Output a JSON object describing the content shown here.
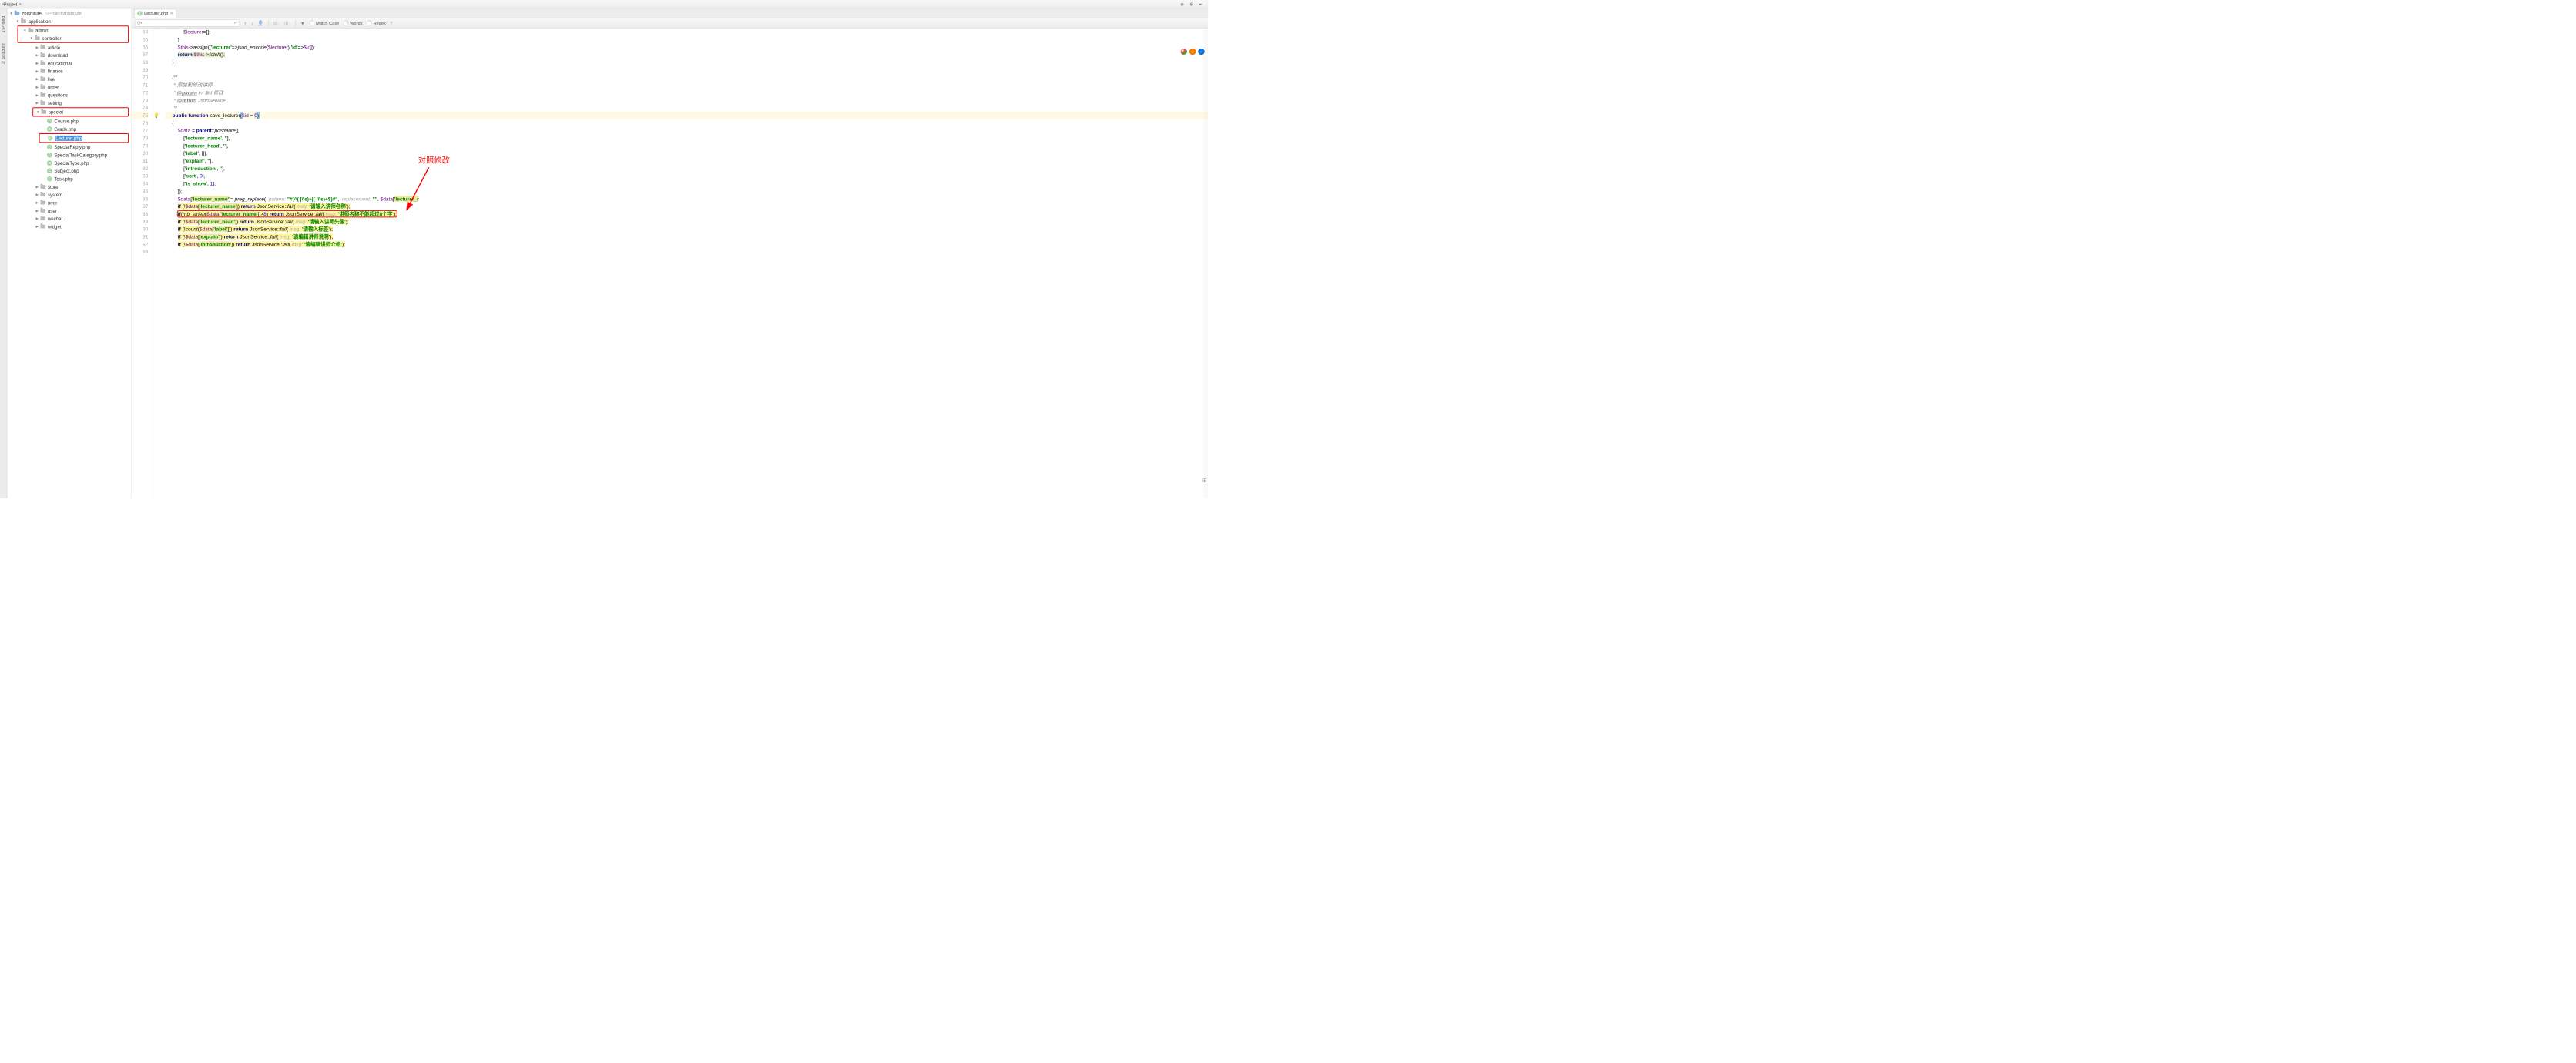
{
  "top_bar": {
    "label": "Project"
  },
  "tree": {
    "root": {
      "name": "zhishifufei",
      "path": "~/Project/zhishifufei"
    },
    "items": [
      {
        "name": "application",
        "indent": 1,
        "arrow": "down",
        "type": "folder"
      },
      {
        "name": "admin",
        "indent": 2,
        "arrow": "down",
        "type": "folder",
        "boxed_start": true
      },
      {
        "name": "controller",
        "indent": 3,
        "arrow": "down",
        "type": "folder",
        "boxed_end": true
      },
      {
        "name": "article",
        "indent": 4,
        "arrow": "right",
        "type": "folder"
      },
      {
        "name": "download",
        "indent": 4,
        "arrow": "right",
        "type": "folder"
      },
      {
        "name": "educational",
        "indent": 4,
        "arrow": "right",
        "type": "folder"
      },
      {
        "name": "finance",
        "indent": 4,
        "arrow": "right",
        "type": "folder"
      },
      {
        "name": "live",
        "indent": 4,
        "arrow": "right",
        "type": "folder"
      },
      {
        "name": "order",
        "indent": 4,
        "arrow": "right",
        "type": "folder"
      },
      {
        "name": "questions",
        "indent": 4,
        "arrow": "right",
        "type": "folder"
      },
      {
        "name": "setting",
        "indent": 4,
        "arrow": "right",
        "type": "folder"
      },
      {
        "name": "special",
        "indent": 4,
        "arrow": "down",
        "type": "folder",
        "boxed_single": true
      },
      {
        "name": "Course.php",
        "indent": 5,
        "arrow": "none",
        "type": "cfile"
      },
      {
        "name": "Grade.php",
        "indent": 5,
        "arrow": "none",
        "type": "cfile"
      },
      {
        "name": "Lecturer.php",
        "indent": 5,
        "arrow": "none",
        "type": "cfile",
        "selected": true,
        "boxed_single": true
      },
      {
        "name": "SpecialReply.php",
        "indent": 5,
        "arrow": "none",
        "type": "cfile"
      },
      {
        "name": "SpecialTaskCategory.php",
        "indent": 5,
        "arrow": "none",
        "type": "cfile"
      },
      {
        "name": "SpecialType.php",
        "indent": 5,
        "arrow": "none",
        "type": "cfile"
      },
      {
        "name": "Subject.php",
        "indent": 5,
        "arrow": "none",
        "type": "cfile"
      },
      {
        "name": "Task.php",
        "indent": 5,
        "arrow": "none",
        "type": "cfile"
      },
      {
        "name": "store",
        "indent": 4,
        "arrow": "right",
        "type": "folder"
      },
      {
        "name": "system",
        "indent": 4,
        "arrow": "right",
        "type": "folder"
      },
      {
        "name": "ump",
        "indent": 4,
        "arrow": "right",
        "type": "folder"
      },
      {
        "name": "user",
        "indent": 4,
        "arrow": "right",
        "type": "folder"
      },
      {
        "name": "wechat",
        "indent": 4,
        "arrow": "right",
        "type": "folder"
      },
      {
        "name": "widget",
        "indent": 4,
        "arrow": "right",
        "type": "folder"
      }
    ]
  },
  "tab": {
    "filename": "Lecturer.php"
  },
  "toolbar": {
    "match_case": "Match Case",
    "words": "Words",
    "regex": "Regex"
  },
  "annotation_text": "对照修改",
  "gutter_start": 64,
  "gutter_end": 93,
  "cursor_line": 75,
  "hints": {
    "pattern": "pattern:",
    "replacement": "replacement:",
    "msg": "msg:"
  },
  "code_strings": {
    "lecturer": "'lecturer'",
    "id": "'id'",
    "lecturer_name": "'lecturer_name'",
    "lecturer_head": "'lecturer_head'",
    "label": "'label'",
    "explain": "'explain'",
    "introduction": "'introduction'",
    "sort": "'sort'",
    "is_show": "'is_show'",
    "empty": "''",
    "regex_pattern": "\"#(^( |\\\\s)+|( |\\\\s)+$)#\"",
    "repl_empty": "\"\"",
    "msg_name": "'请输入讲师名称'",
    "msg_name_limit": "'讲师名称不能超过8个字'",
    "msg_head": "'请输入讲师头像'",
    "msg_label": "'请输入标签'",
    "msg_explain": "'请编辑讲师说明'",
    "msg_intro": "'请编辑讲师介绍'",
    "lecturer_r": "'lecturer_r"
  }
}
